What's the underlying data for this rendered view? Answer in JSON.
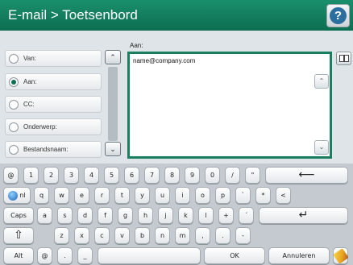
{
  "header": {
    "title": "E-mail > Toetsenbord",
    "help_icon": "question-mark-icon",
    "help_label": "?"
  },
  "recipient": {
    "heading": "Aan:",
    "value": "name@company.com"
  },
  "fields": [
    {
      "label": "Van:",
      "selected": false
    },
    {
      "label": "Aan:",
      "selected": true
    },
    {
      "label": "CC:",
      "selected": false
    },
    {
      "label": "Onderwerp:",
      "selected": false
    },
    {
      "label": "Bestandsnaam:",
      "selected": false
    }
  ],
  "scroll": {
    "up": "⌃",
    "down": "⌄"
  },
  "keyboard": {
    "row1": [
      "@",
      "1",
      "2",
      "3",
      "4",
      "5",
      "6",
      "7",
      "8",
      "9",
      "0",
      "/",
      "\"",
      "⟵"
    ],
    "row2": [
      "nl",
      "q",
      "w",
      "e",
      "r",
      "t",
      "y",
      "u",
      "i",
      "o",
      "p",
      "`",
      "*",
      "<"
    ],
    "row3": [
      "Caps",
      "a",
      "s",
      "d",
      "f",
      "g",
      "h",
      "j",
      "k",
      "l",
      "+",
      "´",
      "↵"
    ],
    "row4": [
      "⇧",
      "z",
      "x",
      "c",
      "v",
      "b",
      "n",
      "m",
      ",",
      ".",
      "-"
    ],
    "row5": [
      "Alt",
      "@",
      ".",
      "_",
      "",
      "OK",
      "Annuleren"
    ]
  },
  "colors": {
    "accent": "#0d6e51",
    "title_bg": "#138060"
  }
}
